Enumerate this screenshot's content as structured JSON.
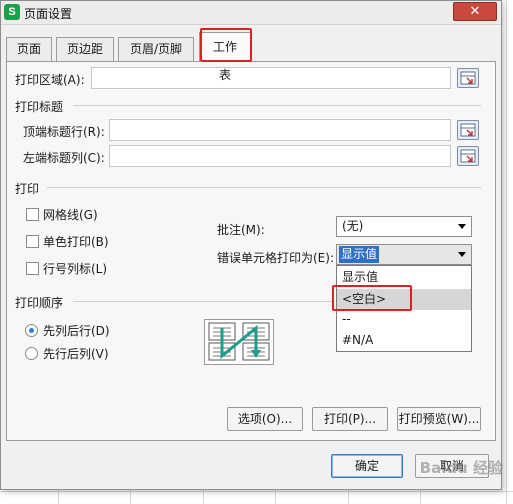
{
  "window": {
    "title": "页面设置",
    "app_icon_glyph": "S",
    "close_glyph": "✕"
  },
  "tabs": [
    {
      "label": "页面"
    },
    {
      "label": "页边距"
    },
    {
      "label": "页眉/页脚"
    },
    {
      "label": "工作表",
      "active": true
    }
  ],
  "print_area": {
    "label": "打印区域(A):",
    "value": ""
  },
  "print_titles": {
    "section": "打印标题",
    "top_rows": {
      "label": "顶端标题行(R):",
      "value": ""
    },
    "left_cols": {
      "label": "左端标题列(C):",
      "value": ""
    }
  },
  "print": {
    "section": "打印",
    "gridlines": {
      "label": "网格线(G)",
      "checked": false
    },
    "mono": {
      "label": "单色打印(B)",
      "checked": false
    },
    "row_col_headers": {
      "label": "行号列标(L)",
      "checked": false
    },
    "comments": {
      "label": "批注(M):",
      "value": "(无)"
    },
    "errors": {
      "label": "错误单元格打印为(E):",
      "value": "显示值",
      "options": [
        "显示值",
        "<空白>",
        "--",
        "#N/A"
      ],
      "hovered_option": "<空白>"
    }
  },
  "page_order": {
    "section": "打印顺序",
    "down_then_over": {
      "label": "先列后行(D)",
      "selected": true
    },
    "over_then_down": {
      "label": "先行后列(V)",
      "selected": false
    }
  },
  "buttons": {
    "options": "选项(O)...",
    "print": "打印(P)...",
    "preview": "打印预览(W)...",
    "ok": "确定",
    "cancel": "取消"
  },
  "watermark": "Baidu 经验",
  "colors": {
    "highlight": "#e02020",
    "app_icon": "#1aa04b",
    "close_button": "#c94a3c",
    "selected_value": "#2f6fc6",
    "radio_dot": "#2d7fd6"
  }
}
